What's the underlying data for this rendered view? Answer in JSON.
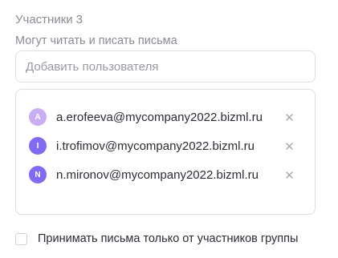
{
  "members_section": {
    "title": "Участники",
    "count": "3"
  },
  "permission": {
    "label": "Могут читать и писать письма"
  },
  "add_user": {
    "placeholder": "Добавить пользователя"
  },
  "members": [
    {
      "initial": "A",
      "email": "a.erofeeva@mycompany2022.bizml.ru",
      "avatar_color": "#c9aef3"
    },
    {
      "initial": "I",
      "email": "i.trofimov@mycompany2022.bizml.ru",
      "avatar_color": "#7f6cf2"
    },
    {
      "initial": "N",
      "email": "n.mironov@mycompany2022.bizml.ru",
      "avatar_color": "#7f6cf2"
    }
  ],
  "remove_icon": "close-icon",
  "accept_only_members": {
    "label": "Принимать письма только от участников группы",
    "checked": false
  }
}
